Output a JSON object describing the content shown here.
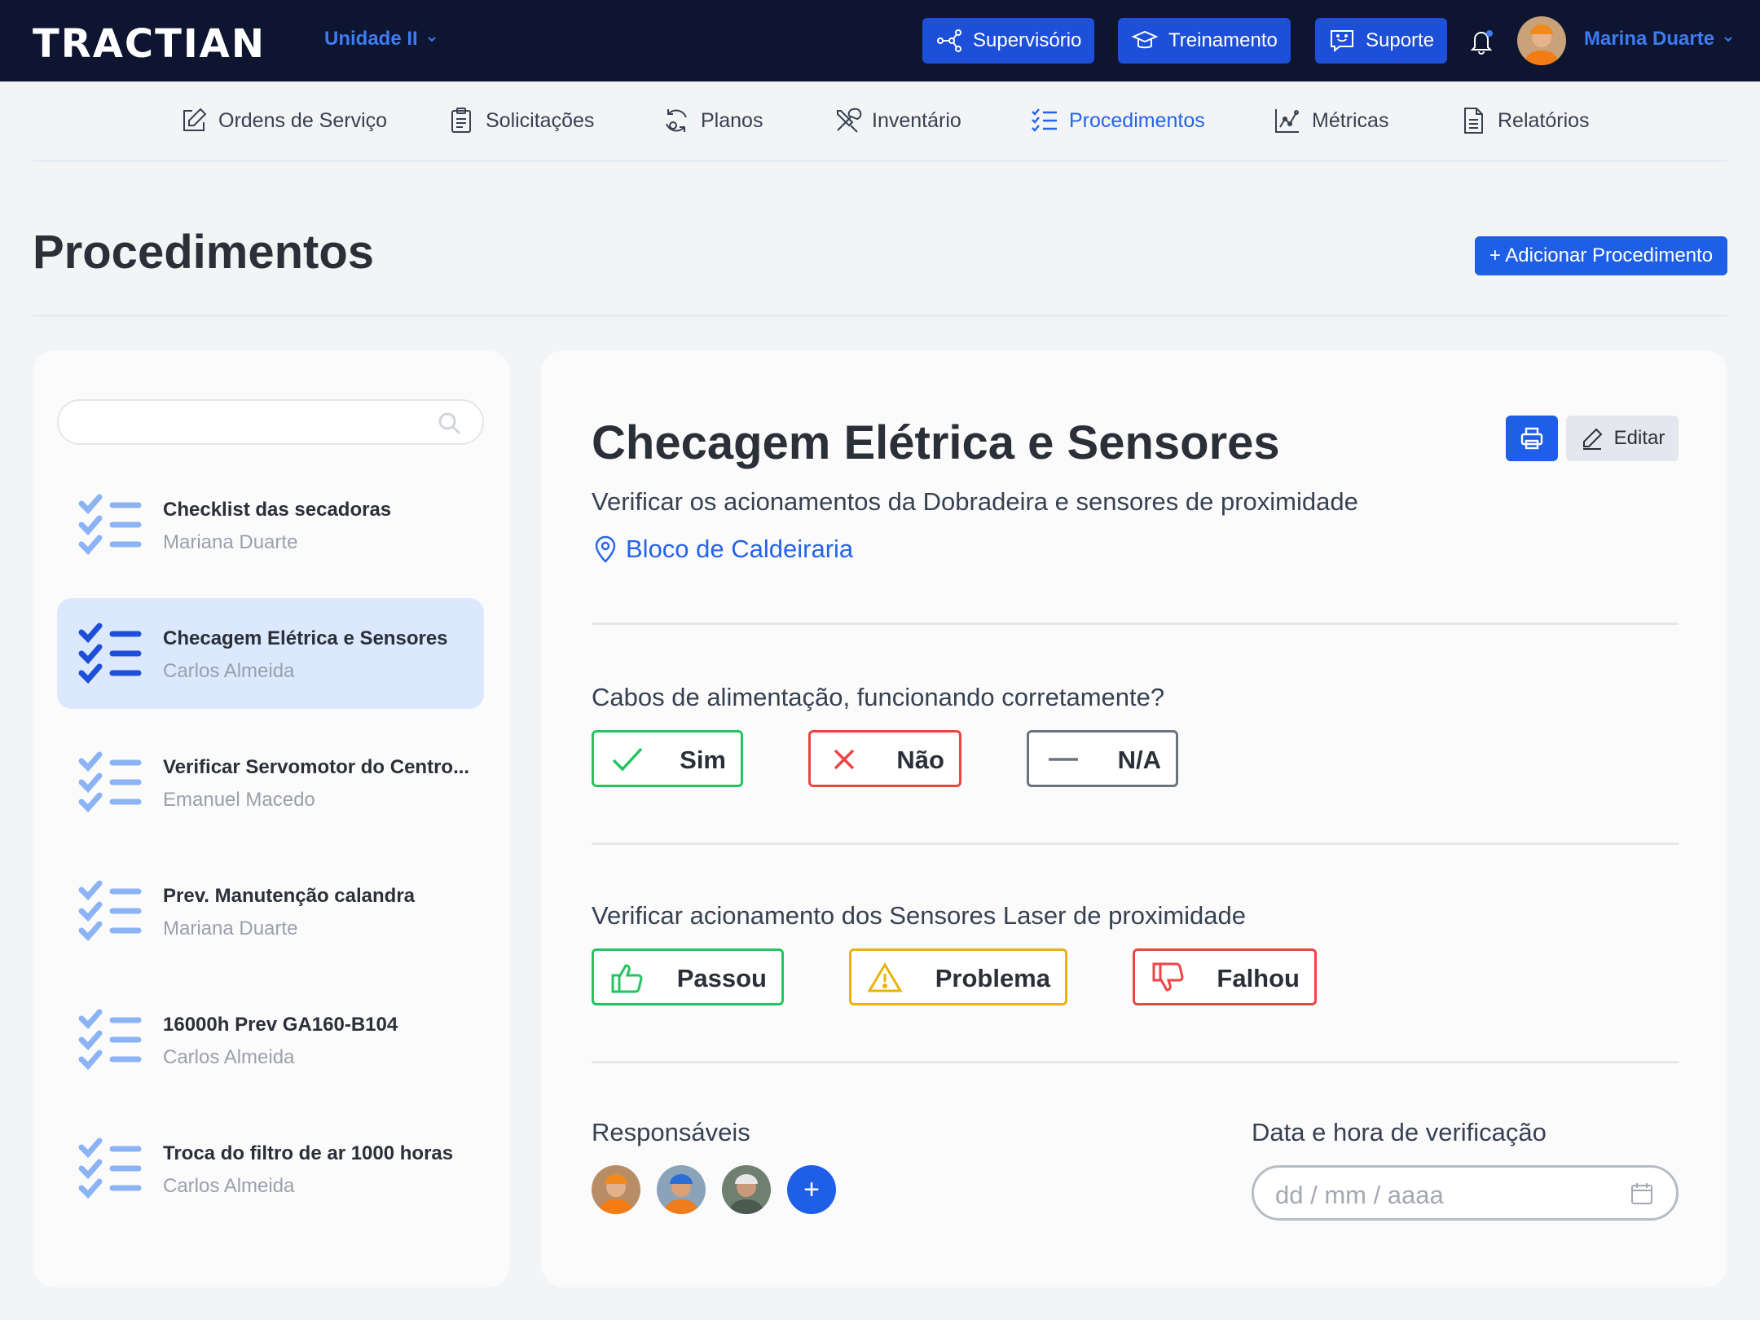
{
  "topbar": {
    "logo": "TRACTIAN",
    "unit": "Unidade II",
    "buttons": [
      {
        "label": "Supervisório"
      },
      {
        "label": "Treinamento"
      },
      {
        "label": "Suporte"
      }
    ],
    "user_name": "Marina Duarte"
  },
  "nav": {
    "items": [
      {
        "label": "Ordens de Serviço",
        "icon": "edit-square-icon"
      },
      {
        "label": "Solicitações",
        "icon": "clipboard-icon"
      },
      {
        "label": "Planos",
        "icon": "refresh-icon"
      },
      {
        "label": "Inventário",
        "icon": "tools-icon"
      },
      {
        "label": "Procedimentos",
        "icon": "checklist-icon",
        "active": true
      },
      {
        "label": "Métricas",
        "icon": "chart-icon"
      },
      {
        "label": "Relatórios",
        "icon": "document-icon"
      }
    ]
  },
  "page": {
    "title": "Procedimentos",
    "add_button": "+ Adicionar Procedimento"
  },
  "procedures": [
    {
      "title": "Checklist das secadoras",
      "author": "Mariana Duarte"
    },
    {
      "title": "Checagem Elétrica e Sensores",
      "author": "Carlos Almeida",
      "selected": true
    },
    {
      "title": "Verificar Servomotor do Centro...",
      "author": "Emanuel Macedo"
    },
    {
      "title": "Prev. Manutenção calandra",
      "author": "Mariana Duarte"
    },
    {
      "title": "16000h Prev GA160-B104",
      "author": "Carlos Almeida"
    },
    {
      "title": "Troca do filtro de ar 1000 horas",
      "author": "Carlos Almeida"
    }
  ],
  "detail": {
    "title": "Checagem Elétrica e Sensores",
    "description": "Verificar os acionamentos da Dobradeira e sensores de proximidade",
    "location": "Bloco de Caldeiraria",
    "edit_label": "Editar",
    "questions": [
      {
        "text": "Cabos de alimentação, funcionando corretamente?",
        "options": [
          "Sim",
          "Não",
          "N/A"
        ]
      },
      {
        "text": "Verificar acionamento dos Sensores Laser de proximidade",
        "options": [
          "Passou",
          "Problema",
          "Falhou"
        ]
      }
    ],
    "responsible_label": "Responsáveis",
    "add_responsible": "+",
    "date_label": "Data e hora de verificação",
    "date_placeholder": "dd / mm / aaaa"
  },
  "colors": {
    "topbar": "#0d1530",
    "accent": "#1f5ee6",
    "link": "#2563eb",
    "selected_bg": "#dbe8fd",
    "green": "#22c55e",
    "red": "#ef4444",
    "yellow": "#eab308"
  }
}
